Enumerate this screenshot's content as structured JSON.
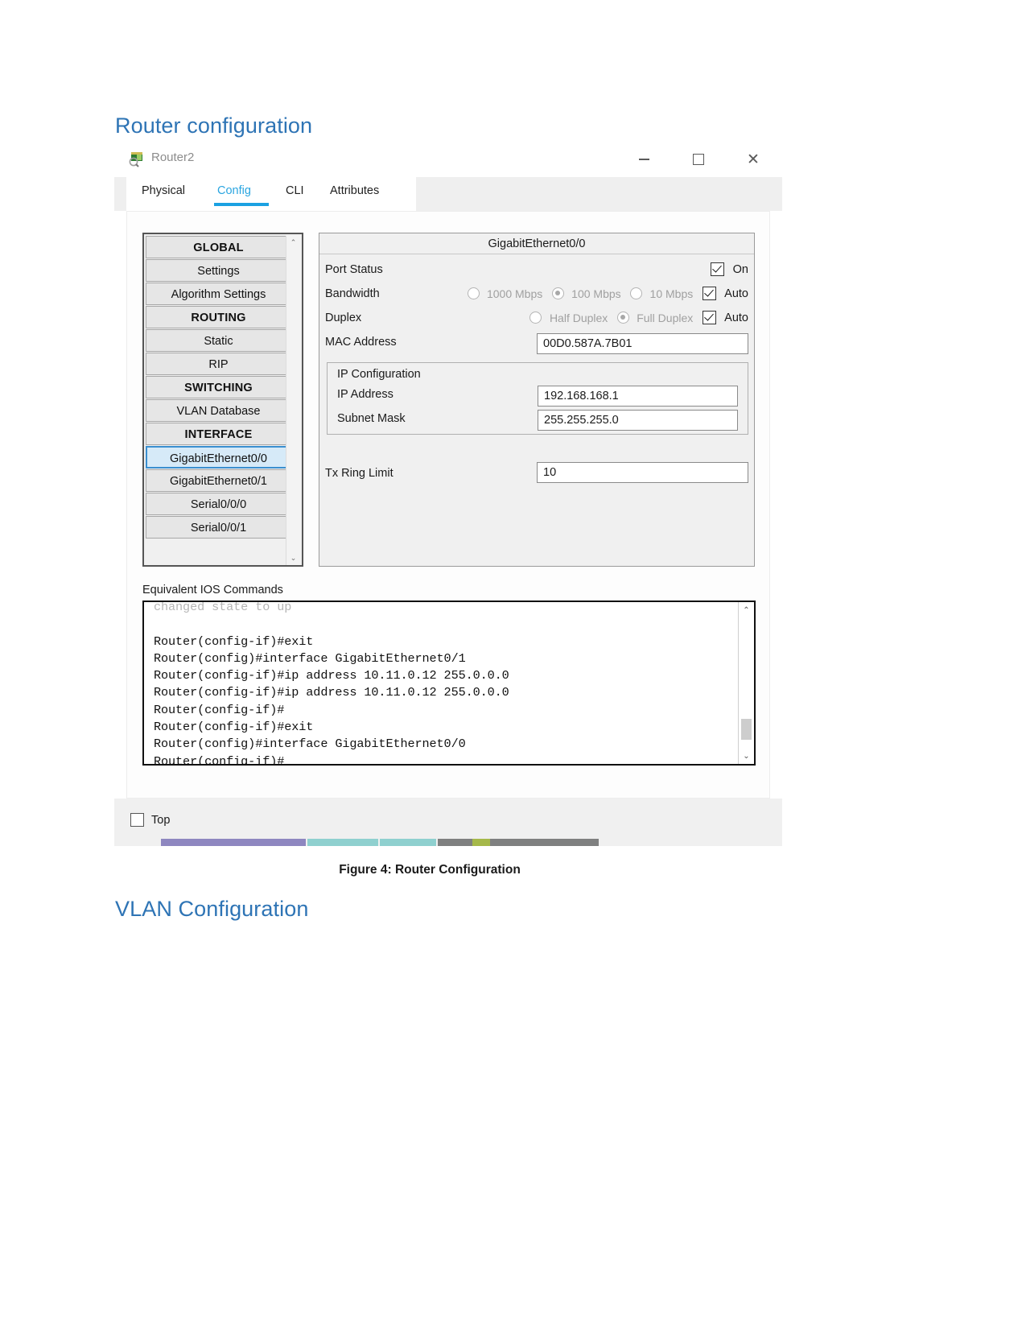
{
  "document": {
    "heading_router": "Router configuration",
    "heading_vlan": "VLAN Configuration",
    "figure_caption": "Figure 4: Router Configuration"
  },
  "window": {
    "title": "Router2",
    "icon": "packet-tracer-router-icon",
    "controls": {
      "minimize": "–",
      "maximize": "□",
      "close": "✕"
    }
  },
  "tabs": [
    {
      "label": "Physical",
      "active": false
    },
    {
      "label": "Config",
      "active": true
    },
    {
      "label": "CLI",
      "active": false
    },
    {
      "label": "Attributes",
      "active": false
    }
  ],
  "sidebar": {
    "items": [
      {
        "label": "GLOBAL",
        "type": "header"
      },
      {
        "label": "Settings",
        "type": "item"
      },
      {
        "label": "Algorithm Settings",
        "type": "item"
      },
      {
        "label": "ROUTING",
        "type": "header"
      },
      {
        "label": "Static",
        "type": "item"
      },
      {
        "label": "RIP",
        "type": "item"
      },
      {
        "label": "SWITCHING",
        "type": "header"
      },
      {
        "label": "VLAN Database",
        "type": "item"
      },
      {
        "label": "INTERFACE",
        "type": "header"
      },
      {
        "label": "GigabitEthernet0/0",
        "type": "item",
        "selected": true
      },
      {
        "label": "GigabitEthernet0/1",
        "type": "item"
      },
      {
        "label": "Serial0/0/0",
        "type": "item"
      },
      {
        "label": "Serial0/0/1",
        "type": "item"
      }
    ],
    "scroll_up": "⌃",
    "scroll_down": "⌄"
  },
  "interface_panel": {
    "title": "GigabitEthernet0/0",
    "port_status": {
      "label": "Port Status",
      "checkbox_label": "On",
      "checked": true
    },
    "bandwidth": {
      "label": "Bandwidth",
      "options": [
        {
          "label": "1000 Mbps",
          "selected": false
        },
        {
          "label": "100 Mbps",
          "selected": true
        },
        {
          "label": "10 Mbps",
          "selected": false
        }
      ],
      "auto_label": "Auto",
      "auto_checked": true
    },
    "duplex": {
      "label": "Duplex",
      "options": [
        {
          "label": "Half Duplex",
          "selected": false
        },
        {
          "label": "Full Duplex",
          "selected": true
        }
      ],
      "auto_label": "Auto",
      "auto_checked": true
    },
    "mac_address": {
      "label": "MAC Address",
      "value": "00D0.587A.7B01"
    },
    "ip_configuration": {
      "title": "IP Configuration",
      "ip_address": {
        "label": "IP Address",
        "value": "192.168.168.1"
      },
      "subnet_mask": {
        "label": "Subnet Mask",
        "value": "255.255.255.0"
      }
    },
    "tx_ring_limit": {
      "label": "Tx Ring Limit",
      "value": "10"
    }
  },
  "ios": {
    "label": "Equivalent IOS Commands",
    "clipped_line": "changed state to up",
    "lines": [
      "",
      "Router(config-if)#exit",
      "Router(config)#interface GigabitEthernet0/1",
      "Router(config-if)#ip address 10.11.0.12 255.0.0.0",
      "Router(config-if)#ip address 10.11.0.12 255.0.0.0",
      "Router(config-if)#",
      "Router(config-if)#exit",
      "Router(config)#interface GigabitEthernet0/0",
      "Router(config-if)#"
    ],
    "scroll_up": "⌃",
    "scroll_down": "⌄"
  },
  "footer": {
    "top_checkbox_label": "Top",
    "top_checked": false
  },
  "colors": {
    "heading_blue": "#2e74b5",
    "tab_accent": "#1ba1e2",
    "selection_blue": "#d6eaf8",
    "selection_border": "#3a8fd0",
    "taskbar_segments": [
      "#8e87c0",
      "#8fd0cf",
      "#7f8080"
    ]
  }
}
